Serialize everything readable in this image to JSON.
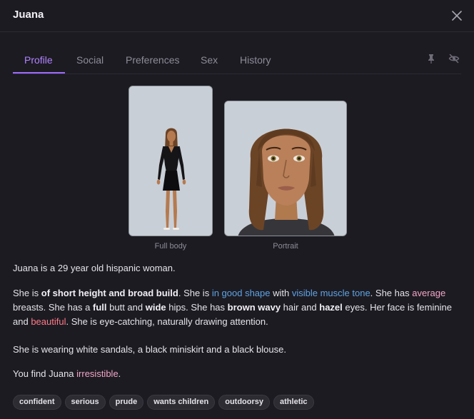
{
  "dialog": {
    "title": "Juana"
  },
  "tabs": [
    {
      "label": "Profile",
      "active": true
    },
    {
      "label": "Social"
    },
    {
      "label": "Preferences"
    },
    {
      "label": "Sex"
    },
    {
      "label": "History"
    }
  ],
  "tab_icons": [
    "pin-icon",
    "eye-off-icon"
  ],
  "images": {
    "full_body": {
      "caption": "Full body"
    },
    "portrait": {
      "caption": "Portrait"
    }
  },
  "description": {
    "intro": "Juana is a 29 year old hispanic woman.",
    "p2": {
      "t1": "She is ",
      "b1": "of short height and broad build",
      "t2": ". She is ",
      "c1": "in good shape",
      "t3": " with ",
      "c2": "visible muscle tone",
      "t4": ". She has ",
      "c3": "average",
      "t5": " breasts. She has a ",
      "b2": "full",
      "t6": " butt and ",
      "b3": "wide",
      "t7": " hips. She has ",
      "b4": "brown wavy",
      "t8": " hair and ",
      "b5": "hazel",
      "t9": " eyes. Her face is feminine and ",
      "c4": "beautiful",
      "t10": ". She is eye-catching, naturally drawing attention."
    },
    "clothing": "She is wearing white sandals, a black miniskirt and a black blouse.",
    "p4": {
      "t1": "You find Juana ",
      "c1": "irresistible",
      "t2": "."
    }
  },
  "tags": [
    "confident",
    "serious",
    "prude",
    "wants children",
    "outdoorsy",
    "athletic"
  ],
  "colors": {
    "accent": "#9f6bff",
    "link_blue": "#5fa3e3",
    "pink": "#f2a6c8",
    "red": "#ff7a87",
    "background": "#1c1b22"
  }
}
